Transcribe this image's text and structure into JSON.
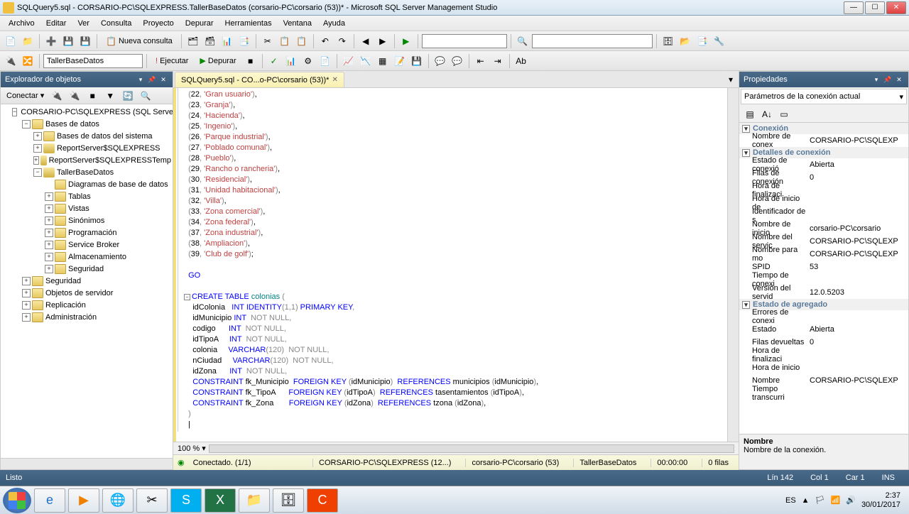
{
  "window": {
    "title": "SQLQuery5.sql - CORSARIO-PC\\SQLEXPRESS.TallerBaseDatos (corsario-PC\\corsario (53))* - Microsoft SQL Server Management Studio"
  },
  "menu": [
    "Archivo",
    "Editar",
    "Ver",
    "Consulta",
    "Proyecto",
    "Depurar",
    "Herramientas",
    "Ventana",
    "Ayuda"
  ],
  "toolbar2": {
    "db": "TallerBaseDatos",
    "execute": "Ejecutar",
    "debug": "Depurar"
  },
  "new_query": "Nueva consulta",
  "panels": {
    "explorer": "Explorador de objetos",
    "props": "Propiedades"
  },
  "connect": "Conectar",
  "tree": {
    "server": "CORSARIO-PC\\SQLEXPRESS (SQL Server",
    "databases": "Bases de datos",
    "sysdb": "Bases de datos del sistema",
    "rs1": "ReportServer$SQLEXPRESS",
    "rs2": "ReportServer$SQLEXPRESSTemp",
    "taller": "TallerBaseDatos",
    "diagrams": "Diagramas de base de datos",
    "tables": "Tablas",
    "views": "Vistas",
    "synonyms": "Sinónimos",
    "programming": "Programación",
    "servicebroker": "Service Broker",
    "storage": "Almacenamiento",
    "security_db": "Seguridad",
    "security": "Seguridad",
    "serverobj": "Objetos de servidor",
    "replication": "Replicación",
    "admin": "Administración"
  },
  "tab": {
    "label": "SQLQuery5.sql - CO...o-PC\\corsario (53))*"
  },
  "sql": {
    "values": [
      {
        "n": "22",
        "s": "Gran usuario",
        "trail": ","
      },
      {
        "n": "23",
        "s": "Granja",
        "trail": ","
      },
      {
        "n": "24",
        "s": "Hacienda",
        "trail": ","
      },
      {
        "n": "25",
        "s": "Ingenio",
        "trail": ","
      },
      {
        "n": "26",
        "s": "Parque industrial",
        "trail": ","
      },
      {
        "n": "27",
        "s": "Poblado comunal",
        "trail": ","
      },
      {
        "n": "28",
        "s": "Pueblo",
        "trail": ","
      },
      {
        "n": "29",
        "s": "Rancho o rancheria",
        "trail": ","
      },
      {
        "n": "30",
        "s": "Residencial",
        "trail": ","
      },
      {
        "n": "31",
        "s": "Unidad habitacional",
        "trail": ","
      },
      {
        "n": "32",
        "s": "Villa",
        "trail": ","
      },
      {
        "n": "33",
        "s": "Zona comercial",
        "trail": ","
      },
      {
        "n": "34",
        "s": "Zona federal",
        "trail": ","
      },
      {
        "n": "37",
        "s": "Zona industrial",
        "trail": ","
      },
      {
        "n": "38",
        "s": "Ampliacion",
        "trail": ","
      },
      {
        "n": "39",
        "s": "Club de golf",
        "trail": ";"
      }
    ],
    "go": "GO",
    "create": "CREATE TABLE",
    "tablename": "colonias",
    "cols": [
      {
        "name": "idColonia",
        "type": "INT",
        "extra_kw": "IDENTITY",
        "extra_args": "(1,1)",
        "extra_tail": " PRIMARY KEY",
        "comma": ","
      },
      {
        "name": "idMunicipio",
        "type": "INT",
        "null": "NOT NULL",
        "comma": ","
      },
      {
        "name": "codigo",
        "type": "INT",
        "null": "NOT NULL",
        "comma": ","
      },
      {
        "name": "idTipoA",
        "type": "INT",
        "null": "NOT NULL",
        "comma": ","
      },
      {
        "name": "colonia",
        "type": "VARCHAR",
        "args": "(120)",
        "null": "NOT NULL",
        "comma": ","
      },
      {
        "name": "nCiudad",
        "type": "VARCHAR",
        "args": "(120)",
        "null": "NOT NULL",
        "comma": ","
      },
      {
        "name": "idZona",
        "type": "INT",
        "null": "NOT NULL",
        "comma": ","
      }
    ],
    "constraints": [
      {
        "name": "fk_Municipio",
        "col": "idMunicipio",
        "ref": "municipios",
        "refcol": "idMunicipio"
      },
      {
        "name": "fk_TipoA",
        "col": "idTipoA",
        "ref": "tasentamientos",
        "refcol": "idTipoA"
      },
      {
        "name": "fk_Zona",
        "col": "idZona",
        "ref": "tzona",
        "refcol": "idZona"
      }
    ]
  },
  "zoom": "100 %",
  "editor_status": {
    "connected_icon": "●",
    "connected": "Conectado. (1/1)",
    "server": "CORSARIO-PC\\SQLEXPRESS (12...)",
    "user": "corsario-PC\\corsario (53)",
    "db": "TallerBaseDatos",
    "time": "00:00:00",
    "rows": "0 filas"
  },
  "props": {
    "combo": "Parámetros de la conexión actual",
    "cat1": "Conexión",
    "rows1": [
      {
        "n": "Nombre de conex",
        "v": "CORSARIO-PC\\SQLEXP"
      }
    ],
    "cat2": "Detalles de conexión",
    "rows2": [
      {
        "n": "Estado de conexió",
        "v": "Abierta"
      },
      {
        "n": "Filas de conexión",
        "v": "0"
      },
      {
        "n": "Hora de finalizaci",
        "v": ""
      },
      {
        "n": "Hora de inicio de",
        "v": ""
      },
      {
        "n": "Identificador de s",
        "v": ""
      },
      {
        "n": "Nombre de inicio",
        "v": "corsario-PC\\corsario"
      },
      {
        "n": "Nombre del servic",
        "v": "CORSARIO-PC\\SQLEXP"
      },
      {
        "n": "Nombre para mo",
        "v": "CORSARIO-PC\\SQLEXP"
      },
      {
        "n": "SPID",
        "v": "53"
      },
      {
        "n": "Tiempo de conexi",
        "v": ""
      },
      {
        "n": "Versión del servid",
        "v": "12.0.5203"
      }
    ],
    "cat3": "Estado de agregado",
    "rows3": [
      {
        "n": "Errores de conexi",
        "v": ""
      },
      {
        "n": "Estado",
        "v": "Abierta"
      },
      {
        "n": "Filas devueltas",
        "v": "0"
      },
      {
        "n": "Hora de finalizaci",
        "v": ""
      },
      {
        "n": "Hora de inicio",
        "v": ""
      },
      {
        "n": "Nombre",
        "v": "CORSARIO-PC\\SQLEXP"
      },
      {
        "n": "Tiempo transcurri",
        "v": ""
      }
    ],
    "desc_name": "Nombre",
    "desc_text": "Nombre de la conexión."
  },
  "status": {
    "ready": "Listo",
    "line": "Lín 142",
    "col": "Col 1",
    "car": "Car 1",
    "ins": "INS"
  },
  "tray": {
    "lang": "ES",
    "time": "2:37",
    "date": "30/01/2017"
  }
}
